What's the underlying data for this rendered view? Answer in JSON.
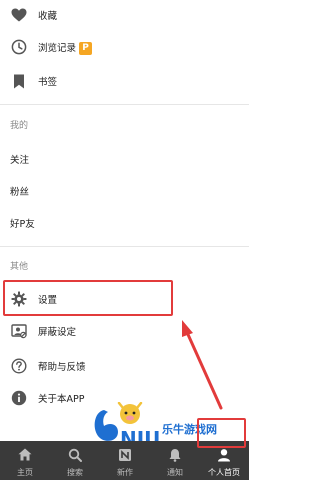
{
  "menu": {
    "favorites": "收藏",
    "history": "浏览记录",
    "history_badge": "P",
    "bookmarks": "书签"
  },
  "mine": {
    "section_title": "我的",
    "following": "关注",
    "fans": "粉丝",
    "friends": "好P友"
  },
  "other": {
    "section_title": "其他",
    "settings": "设置",
    "block_settings": "屏蔽设定",
    "help_feedback": "帮助与反馈",
    "about": "关于本APP"
  },
  "tabs": [
    {
      "label": "主页",
      "icon": "home-icon"
    },
    {
      "label": "搜索",
      "icon": "search-icon"
    },
    {
      "label": "新作",
      "icon": "new-works-icon"
    },
    {
      "label": "通知",
      "icon": "bell-icon"
    },
    {
      "label": "个人首页",
      "icon": "user-icon"
    }
  ],
  "watermark": {
    "text": "乐牛游戏网"
  },
  "colors": {
    "accent_red": "#e23b3b",
    "badge_orange": "#f5a623",
    "tabbar_bg": "#3a3a3a"
  }
}
